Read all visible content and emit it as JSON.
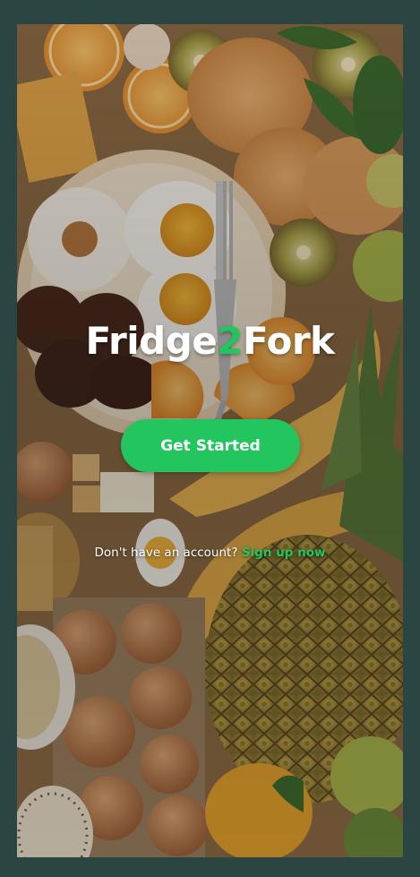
{
  "brand": {
    "part1": "Fridge",
    "part2": "2",
    "part3": "Fork"
  },
  "cta": {
    "label": "Get Started"
  },
  "signup": {
    "prompt": "Don't have an account?",
    "link": "Sign up now"
  },
  "colors": {
    "accent": "#22c55e",
    "outer_background": "#2a4542",
    "text": "#ffffff"
  }
}
